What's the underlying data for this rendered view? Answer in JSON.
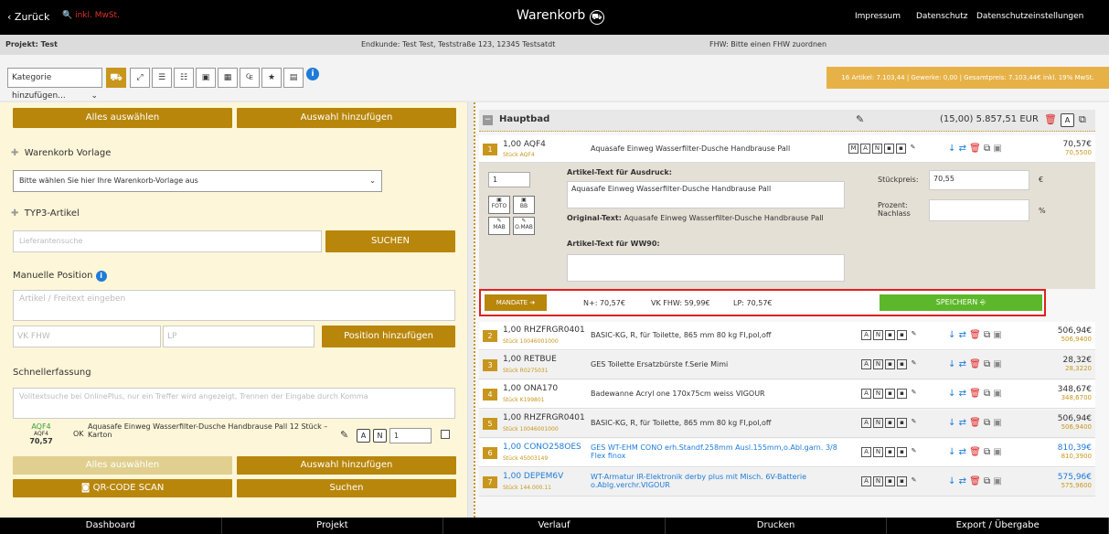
{
  "header": {
    "back": "Zurück",
    "vat": "inkl. MwSt.",
    "title": "Warenkorb",
    "links": [
      "Impressum",
      "Datenschutz",
      "Datenschutzeinstellungen"
    ]
  },
  "info": {
    "projekt": "Projekt: Test",
    "endkunde": "Endkunde: Test Test, Teststraße 123, 12345 Testsatdt",
    "fhw": "FHW: Bitte einen FHW zuordnen"
  },
  "toolbar": {
    "category": "Kategorie hinzufügen...",
    "summary": "16 Artikel: 7.103,44 | Gewerke: 0,00 | Gesamtpreis: 7.103,44€ inkl. 19% MwSt."
  },
  "left": {
    "select_all": "Alles auswählen",
    "add_selection": "Auswahl hinzufügen",
    "template_title": "Warenkorb Vorlage",
    "template_select": "Bitte wählen Sie hier Ihre Warenkorb-Vorlage aus",
    "typ3_title": "TYP3-Artikel",
    "supplier_placeholder": "Lieferantensuche",
    "search_btn": "SUCHEN",
    "manual_title": "Manuelle Position",
    "article_placeholder": "Artikel / Freitext eingeben",
    "vk_placeholder": "VK FHW",
    "lp_placeholder": "LP",
    "add_position": "Position hinzufügen",
    "quick_title": "Schnellerfassung",
    "quick_placeholder": "Volltextsuche bei OnlinePlus, nur ein Treffer wird angezeigt, Trennen der Eingabe durch Komma",
    "quick_code": "AQF4",
    "quick_code2": "AQF4",
    "quick_price": "70,57",
    "quick_ok": "OK",
    "quick_desc": "Aquasafe Einweg Wasserfilter-Dusche Handbrause Pall 12 Stück – Karton",
    "quick_qty": "1",
    "select_all2": "Alles auswählen",
    "add_selection2": "Auswahl hinzufügen",
    "qr": "QR-CODE SCAN",
    "search2": "Suchen"
  },
  "group": {
    "name": "Hauptbad",
    "total": "(15,00) 5.857,51 EUR"
  },
  "first": {
    "no": "1",
    "qty": "1,00",
    "code": "AQF4",
    "unit": "Stück AQF4",
    "desc": "Aquasafe Einweg Wasserfilter-Dusche Handbrause Pall",
    "price": "70,57€",
    "price2": "70,5500",
    "qty_input": "1",
    "label_text": "Artikel-Text für Ausdruck:",
    "text_value": "Aquasafe Einweg Wasserfilter-Dusche Handbrause Pall",
    "orig_label": "Original-Text:",
    "orig_value": "Aquasafe Einweg Wasserfilter-Dusche Handbrause Pall",
    "ww90": "Artikel-Text für WW90:",
    "stueck_label": "Stückpreis:",
    "stueck_value": "70,55",
    "euro": "€",
    "prozent_label": "Prozent: Nachlass",
    "pct": "%",
    "btns": [
      "FOTO",
      "BB",
      "MAB",
      "O.MAB"
    ],
    "mandate": "MANDATE",
    "n_plus": "N+: 70,57€",
    "vk_fhw": "VK FHW: 59,99€",
    "lp": "LP: 70,57€",
    "save": "SPEICHERN"
  },
  "rows": [
    {
      "no": "2",
      "qty": "1,00",
      "code": "RHZFRGR0401",
      "unit": "Stück 10046001000",
      "desc": "BASIC-KG, R, für Toilette, 865 mm 80 kg FI,pol,off",
      "price": "506,94€",
      "price2": "506,9400",
      "blue": false
    },
    {
      "no": "3",
      "qty": "1,00",
      "code": "RETBUE",
      "unit": "Stück R0275031",
      "desc": "GES Toilette Ersatzbürste f.Serie Mimi",
      "price": "28,32€",
      "price2": "28,3220",
      "blue": false
    },
    {
      "no": "4",
      "qty": "1,00",
      "code": "ONA170",
      "unit": "Stück K199801",
      "desc": "Badewanne Acryl one 170x75cm weiss VIGOUR",
      "price": "348,67€",
      "price2": "348,6700",
      "blue": false
    },
    {
      "no": "5",
      "qty": "1,00",
      "code": "RHZFRGR0401",
      "unit": "Stück 10046001000",
      "desc": "BASIC-KG, R, für Toilette, 865 mm 80 kg FI,pol,off",
      "price": "506,94€",
      "price2": "506,9400",
      "blue": false
    },
    {
      "no": "6",
      "qty": "1,00",
      "code": "CONO258OES",
      "unit": "Stück 45003149",
      "desc": "GES WT-EHM CONO erh.Standf.258mm Ausl.155mm,o.Abl.garn. 3/8 Flex finox",
      "price": "810,39€",
      "price2": "810,3900",
      "blue": true
    },
    {
      "no": "7",
      "qty": "1,00",
      "code": "DEPEM6V",
      "unit": "Stück 144.000.11",
      "desc": "WT-Armatur IR-Elektronik derby plus mit Misch. 6V-Batterie o.Ablg.verchr.VIGOUR",
      "price": "575,96€",
      "price2": "575,9600",
      "blue": true
    }
  ],
  "footer": [
    "Dashboard",
    "Projekt",
    "Verlauf",
    "Drucken",
    "Export / Übergabe"
  ]
}
